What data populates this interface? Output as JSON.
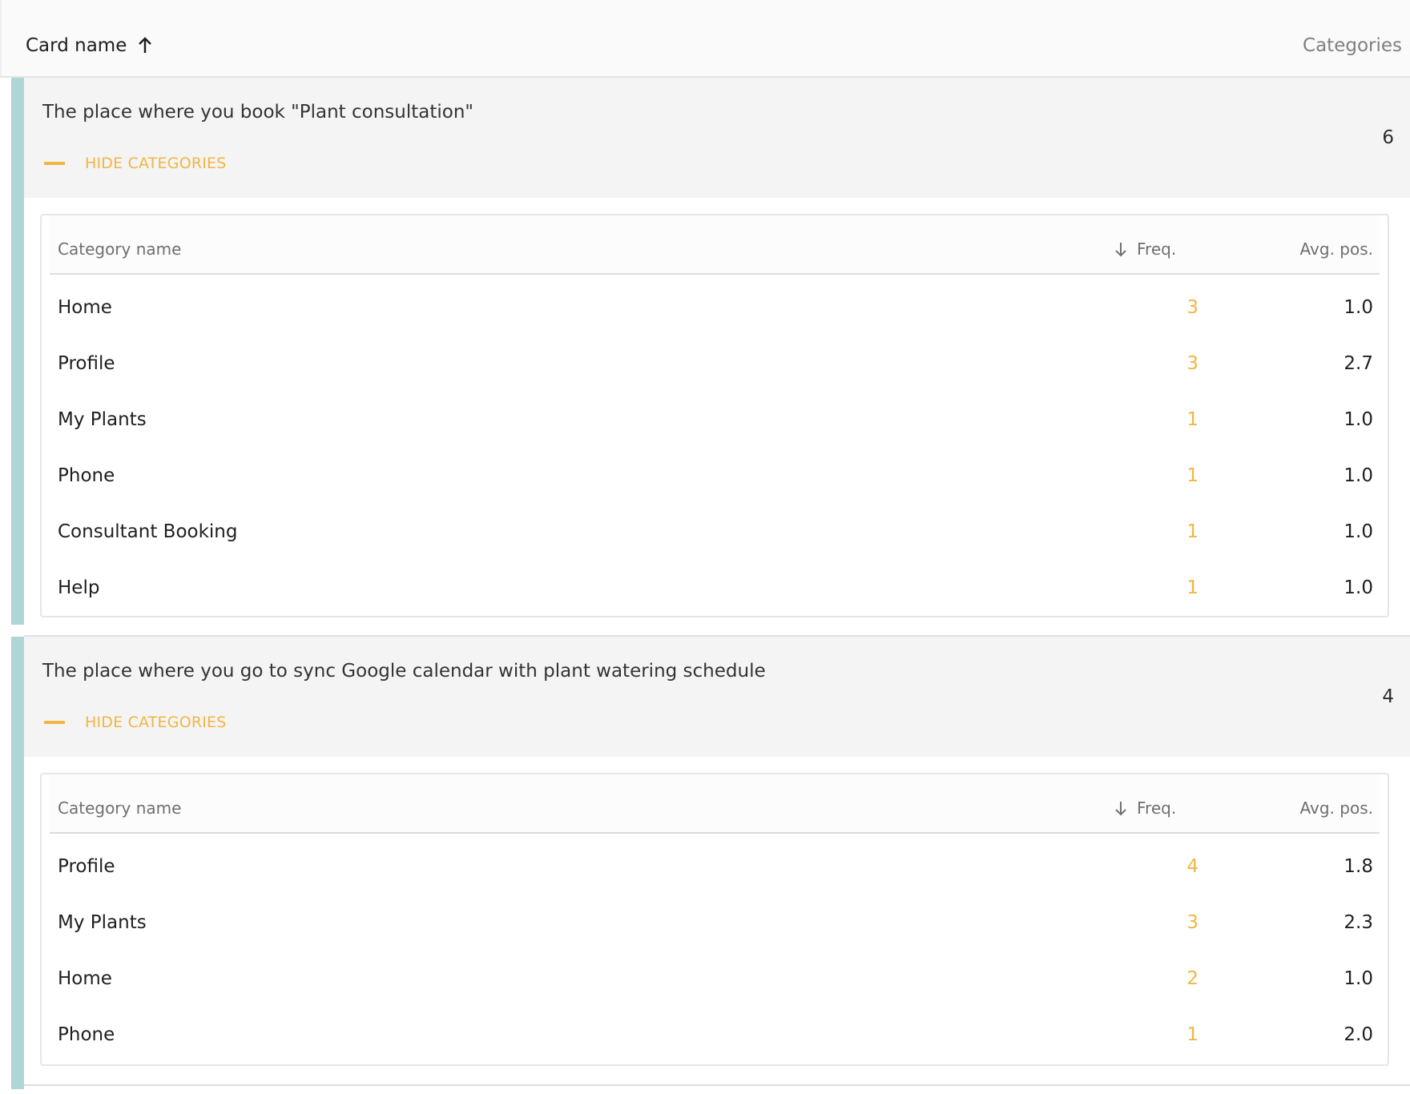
{
  "header": {
    "card_name_label": "Card name",
    "categories_label": "Categories"
  },
  "columns": {
    "category_name": "Category name",
    "freq": "Freq.",
    "avg_pos": "Avg. pos."
  },
  "colors": {
    "accent_bar": "#aed6d6",
    "orange": "#f1b544"
  },
  "cards": [
    {
      "title": "The place where you book \"Plant consultation\"",
      "count": "6",
      "toggle_label": "HIDE CATEGORIES",
      "rows": [
        {
          "name": "Home",
          "freq": "3",
          "avg": "1.0"
        },
        {
          "name": "Profile",
          "freq": "3",
          "avg": "2.7"
        },
        {
          "name": "My Plants",
          "freq": "1",
          "avg": "1.0"
        },
        {
          "name": "Phone",
          "freq": "1",
          "avg": "1.0"
        },
        {
          "name": "Consultant Booking",
          "freq": "1",
          "avg": "1.0"
        },
        {
          "name": "Help",
          "freq": "1",
          "avg": "1.0"
        }
      ]
    },
    {
      "title": "The place where you go to sync Google calendar with plant watering schedule",
      "count": "4",
      "toggle_label": "HIDE CATEGORIES",
      "rows": [
        {
          "name": "Profile",
          "freq": "4",
          "avg": "1.8"
        },
        {
          "name": "My Plants",
          "freq": "3",
          "avg": "2.3"
        },
        {
          "name": "Home",
          "freq": "2",
          "avg": "1.0"
        },
        {
          "name": "Phone",
          "freq": "1",
          "avg": "2.0"
        }
      ]
    }
  ]
}
